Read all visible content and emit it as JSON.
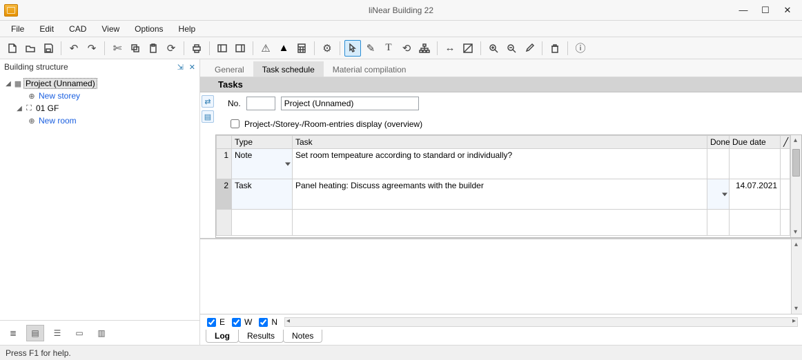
{
  "app": {
    "title": "liNear Building 22"
  },
  "menus": [
    "File",
    "Edit",
    "CAD",
    "View",
    "Options",
    "Help"
  ],
  "left": {
    "panel_title": "Building structure",
    "tree": {
      "root": "Project (Unnamed)",
      "new_storey": "New storey",
      "node1": "01 GF",
      "new_room": "New room"
    }
  },
  "right": {
    "tabs": {
      "general": "General",
      "task": "Task schedule",
      "material": "Material compilation"
    },
    "section": "Tasks",
    "no_label": "No.",
    "no_value": "",
    "project_name": "Project (Unnamed)",
    "overview_check": "Project-/Storey-/Room-entries display (overview)",
    "table": {
      "headers": {
        "type": "Type",
        "task": "Task",
        "done": "Done",
        "due": "Due date"
      },
      "rows": [
        {
          "n": "1",
          "type": "Note",
          "task": "Set room tempeature according to standard or individually?",
          "done": "",
          "due": ""
        },
        {
          "n": "2",
          "type": "Task",
          "task": "Panel heating: Discuss agreemants with the builder",
          "done": "",
          "due": "14.07.2021"
        }
      ]
    },
    "ewn": {
      "e": "E",
      "w": "W",
      "n": "N"
    },
    "bottom_tabs": {
      "log": "Log",
      "results": "Results",
      "notes": "Notes"
    }
  },
  "status": "Press F1 for help."
}
